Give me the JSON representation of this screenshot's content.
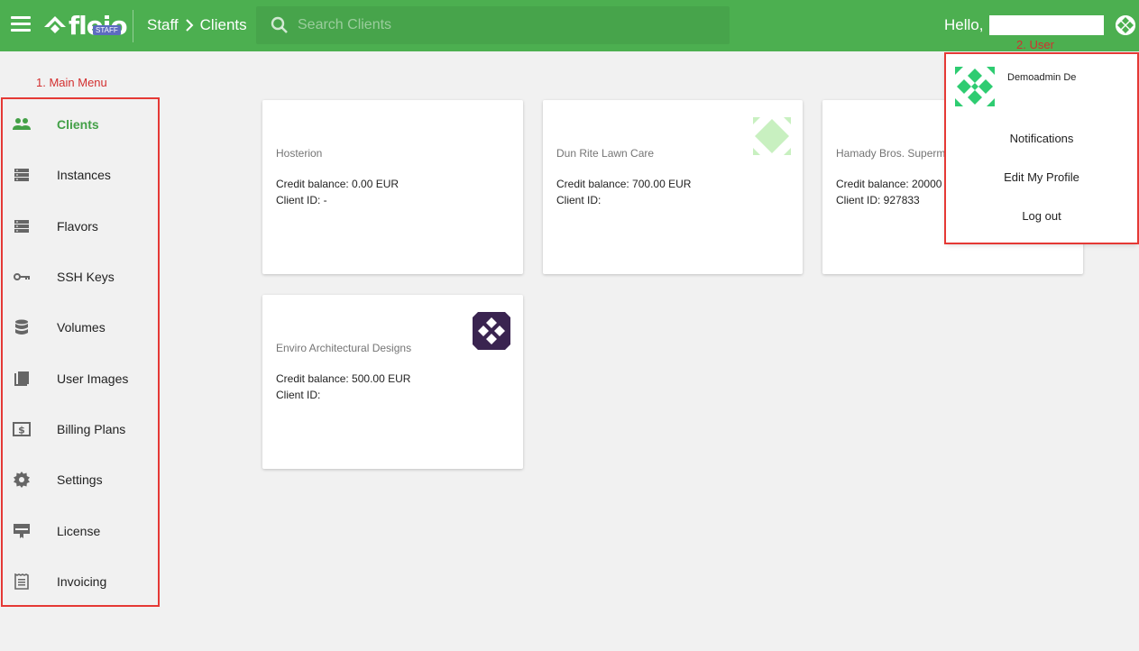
{
  "header": {
    "logo_text": "fleio",
    "logo_badge": "STAFF",
    "breadcrumb": [
      "Staff",
      "Clients"
    ],
    "search_placeholder": "Search Clients",
    "hello": "Hello,"
  },
  "annotations": {
    "main_menu": "1. Main Menu",
    "user": "2. User"
  },
  "sidebar": {
    "items": [
      {
        "label": "Clients",
        "icon": "people-icon",
        "active": true
      },
      {
        "label": "Instances",
        "icon": "server-icon"
      },
      {
        "label": "Flavors",
        "icon": "server-icon"
      },
      {
        "label": "SSH Keys",
        "icon": "key-icon"
      },
      {
        "label": "Volumes",
        "icon": "database-icon"
      },
      {
        "label": "User Images",
        "icon": "image-stack-icon"
      },
      {
        "label": "Billing Plans",
        "icon": "dollar-box-icon"
      },
      {
        "label": "Settings",
        "icon": "gear-icon"
      },
      {
        "label": "License",
        "icon": "certificate-icon"
      },
      {
        "label": "Invoicing",
        "icon": "receipt-icon"
      }
    ]
  },
  "clients": [
    {
      "name": "Hosterion",
      "balance": "Credit balance: 0.00 EUR",
      "client_id": "Client ID: -"
    },
    {
      "name": "Dun Rite Lawn Care",
      "balance": "Credit balance: 700.00 EUR",
      "client_id": "Client ID:"
    },
    {
      "name": "Hamady Bros. Superm",
      "balance": "Credit balance: 20000",
      "client_id": "Client ID: 927833"
    },
    {
      "name": "Enviro Architectural Designs",
      "balance": "Credit balance: 500.00 EUR",
      "client_id": "Client ID:"
    }
  ],
  "user_menu": {
    "name": "Demoadmin De",
    "items": [
      "Notifications",
      "Edit My Profile",
      "Log out"
    ]
  },
  "colors": {
    "brand_green": "#4caf50",
    "active_green": "#43a047",
    "annotation_red": "#e53935"
  }
}
